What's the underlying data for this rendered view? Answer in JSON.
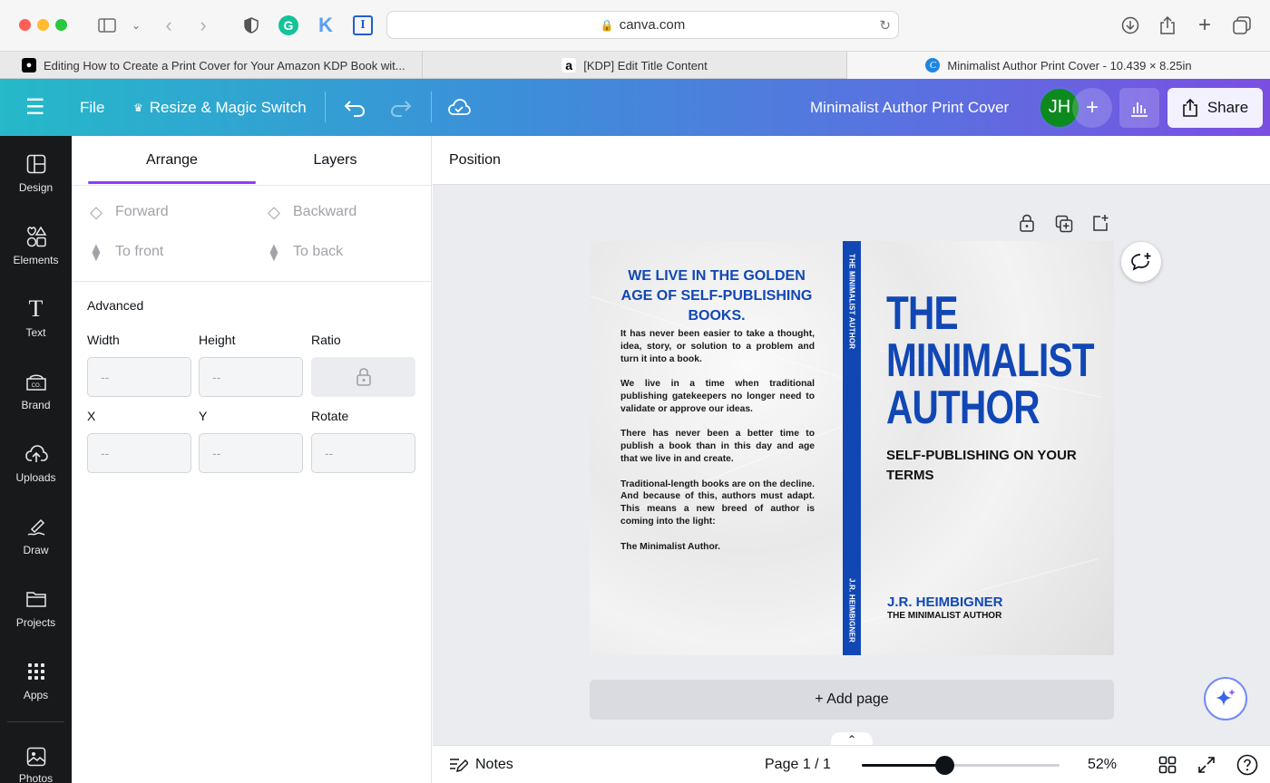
{
  "browser": {
    "url": "canva.com",
    "tabs": [
      {
        "label": "Editing How to Create a Print Cover for Your Amazon KDP Book wit..."
      },
      {
        "label": "[KDP] Edit Title Content"
      },
      {
        "label": "Minimalist Author Print Cover - 10.439 × 8.25in"
      }
    ]
  },
  "header": {
    "file": "File",
    "resize": "Resize & Magic Switch",
    "design_title": "Minimalist Author Print Cover",
    "avatar_initials": "JH",
    "share": "Share"
  },
  "rail": {
    "items": [
      {
        "label": "Design"
      },
      {
        "label": "Elements"
      },
      {
        "label": "Text"
      },
      {
        "label": "Brand"
      },
      {
        "label": "Uploads"
      },
      {
        "label": "Draw"
      },
      {
        "label": "Projects"
      },
      {
        "label": "Apps"
      },
      {
        "label": "Photos"
      }
    ]
  },
  "panel": {
    "tabs": [
      "Arrange",
      "Layers"
    ],
    "buttons": {
      "forward": "Forward",
      "backward": "Backward",
      "to_front": "To front",
      "to_back": "To back"
    },
    "advanced": "Advanced",
    "labels": {
      "width": "Width",
      "height": "Height",
      "ratio": "Ratio",
      "x": "X",
      "y": "Y",
      "rotate": "Rotate"
    },
    "placeholder": "--"
  },
  "toolbar": {
    "position": "Position"
  },
  "cover": {
    "back_heading": "WE LIVE IN THE GOLDEN AGE OF SELF-PUBLISHING BOOKS.",
    "paragraphs": [
      "It has never been easier to take a thought, idea, story, or solution to a problem and turn it into a book.",
      "We live in a time when traditional publishing gatekeepers no longer need to validate or approve our ideas.",
      "There has never been a better time to publish a book than in this day and age that we live in and create.",
      "Traditional-length books are on the decline. And because of this, authors must adapt. This means a new breed of author is coming into the light:",
      "The Minimalist Author."
    ],
    "spine_title": "THE MINIMALIST AUTHOR",
    "spine_author": "J.R. HEIMBIGNER",
    "title_lines": [
      "THE",
      "MINIMALIST",
      "AUTHOR"
    ],
    "subtitle": "SELF-PUBLISHING ON YOUR TERMS",
    "author": "J.R. HEIMBIGNER",
    "author_tag": "THE MINIMALIST AUTHOR"
  },
  "add_page": "+ Add page",
  "bottom": {
    "notes": "Notes",
    "page": "Page 1 / 1",
    "zoom": "52%",
    "zoom_level": 0.42
  },
  "colors": {
    "accent": "#1147b5",
    "brand_purple": "#7b4ee2",
    "rail": "#18191b"
  }
}
